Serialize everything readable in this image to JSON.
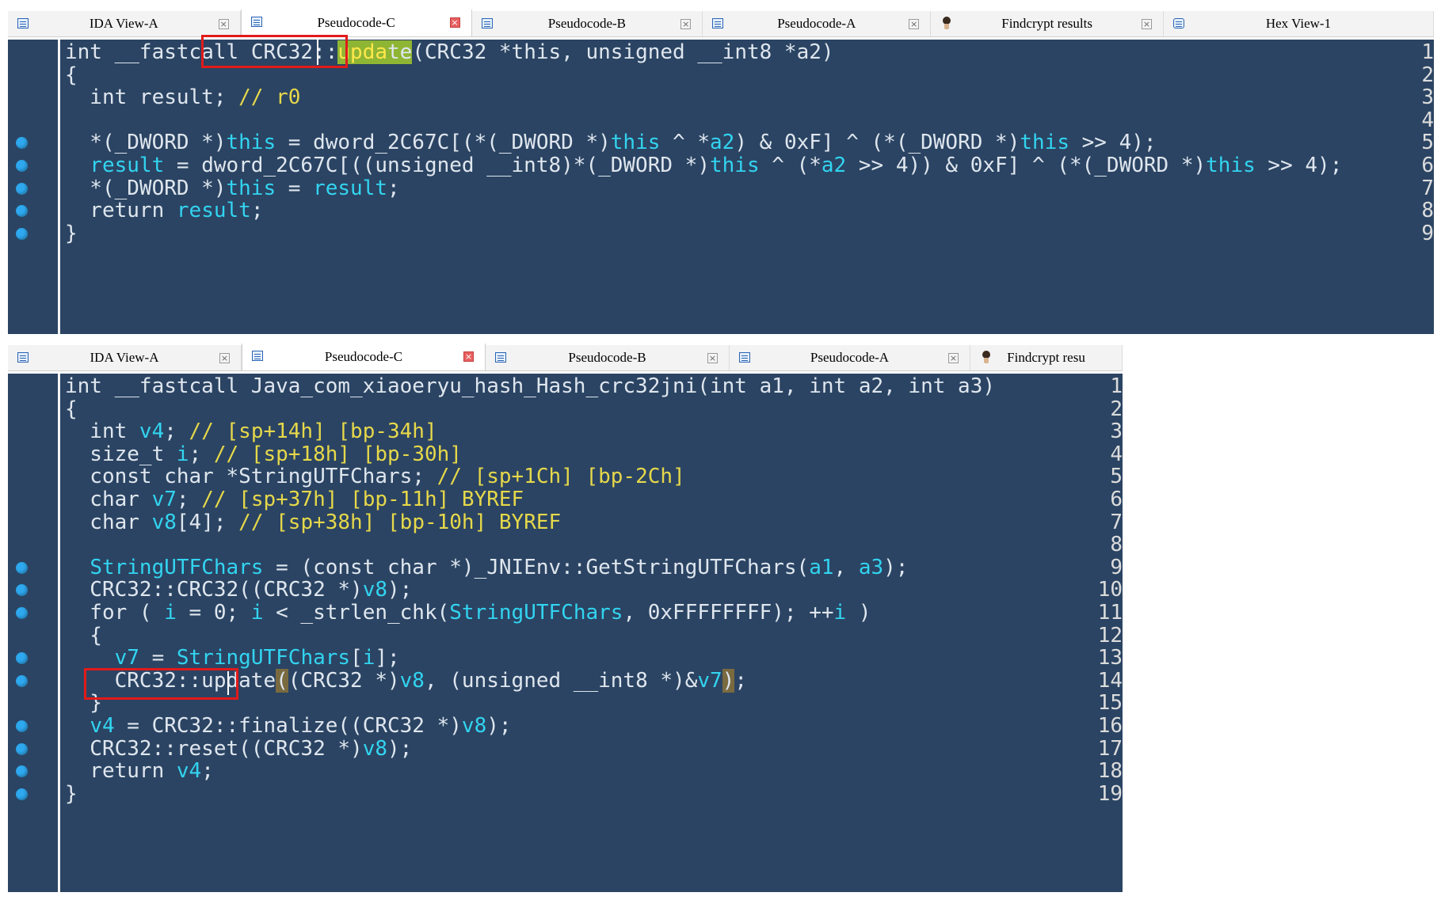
{
  "top": {
    "tabs": [
      {
        "label": "IDA View-A",
        "icon": "ida-view-icon",
        "active": false
      },
      {
        "label": "Pseudocode-C",
        "icon": "pseudocode-icon",
        "active": true
      },
      {
        "label": "Pseudocode-B",
        "icon": "pseudocode-icon",
        "active": false
      },
      {
        "label": "Pseudocode-A",
        "icon": "pseudocode-icon",
        "active": false
      },
      {
        "label": "Findcrypt results",
        "icon": "findcrypt-icon",
        "active": false
      },
      {
        "label": "Hex View-1",
        "icon": "hex-view-icon",
        "active": false
      }
    ],
    "lines": [
      {
        "n": "1",
        "bp": false
      },
      {
        "n": "2",
        "bp": false
      },
      {
        "n": "3",
        "bp": false
      },
      {
        "n": "4",
        "bp": false
      },
      {
        "n": "5",
        "bp": true
      },
      {
        "n": "6",
        "bp": true
      },
      {
        "n": "7",
        "bp": true
      },
      {
        "n": "8",
        "bp": true
      },
      {
        "n": "9",
        "bp": true
      }
    ]
  },
  "bottom": {
    "tabs": [
      {
        "label": "IDA View-A",
        "icon": "ida-view-icon",
        "active": false
      },
      {
        "label": "Pseudocode-C",
        "icon": "pseudocode-icon",
        "active": true
      },
      {
        "label": "Pseudocode-B",
        "icon": "pseudocode-icon",
        "active": false
      },
      {
        "label": "Pseudocode-A",
        "icon": "pseudocode-icon",
        "active": false
      },
      {
        "label": "Findcrypt resu",
        "icon": "findcrypt-icon",
        "active": false
      }
    ],
    "lines": [
      {
        "n": "1",
        "bp": false
      },
      {
        "n": "2",
        "bp": false
      },
      {
        "n": "3",
        "bp": false
      },
      {
        "n": "4",
        "bp": false
      },
      {
        "n": "5",
        "bp": false
      },
      {
        "n": "6",
        "bp": false
      },
      {
        "n": "7",
        "bp": false
      },
      {
        "n": "8",
        "bp": false
      },
      {
        "n": "9",
        "bp": true
      },
      {
        "n": "10",
        "bp": true
      },
      {
        "n": "11",
        "bp": true
      },
      {
        "n": "12",
        "bp": false
      },
      {
        "n": "13",
        "bp": true
      },
      {
        "n": "14",
        "bp": true
      },
      {
        "n": "15",
        "bp": false
      },
      {
        "n": "16",
        "bp": true
      },
      {
        "n": "17",
        "bp": true
      },
      {
        "n": "18",
        "bp": true
      },
      {
        "n": "19",
        "bp": true
      }
    ]
  },
  "code": {
    "t1": [
      "int",
      " __fastcall ",
      "CRC32::",
      "upda",
      "te",
      "(CRC32 *this, unsigned __int8 *a2)"
    ],
    "t2": "{",
    "t3": [
      "  int result; ",
      "// r0"
    ],
    "t4": "",
    "t5": [
      "  *(_DWORD *)",
      "this",
      " = dword_2C67C[(*(_DWORD *)",
      "this",
      " ^ *",
      "a2",
      ") & 0xF] ^ (*(_DWORD *)",
      "this",
      " >> 4);"
    ],
    "t6": [
      "  ",
      "result",
      " = dword_2C67C[((unsigned __int8)*(_DWORD *)",
      "this",
      " ^ (*",
      "a2",
      " >> 4)) & 0xF] ^ (*(_DWORD *)",
      "this",
      " >> 4);"
    ],
    "t7": [
      "  *(_DWORD *)",
      "this",
      " = ",
      "result",
      ";"
    ],
    "t8": [
      "  return ",
      "result",
      ";"
    ],
    "t9": "}",
    "b1": [
      "int __fastcall Java_com_xiaoeryu_hash_Hash_crc32jni(int a1, int a2, int a3)"
    ],
    "b2": "{",
    "b3": [
      "  int ",
      "v4",
      "; ",
      "// [sp+14h] [bp-34h]"
    ],
    "b4": [
      "  size_t ",
      "i",
      "; ",
      "// [sp+18h] [bp-30h]"
    ],
    "b5": [
      "  const char *StringUTFChars; ",
      "// [sp+1Ch] [bp-2Ch]"
    ],
    "b6": [
      "  char ",
      "v7",
      "; ",
      "// [sp+37h] [bp-11h] BYREF"
    ],
    "b7": [
      "  char ",
      "v8",
      "[4]; ",
      "// [sp+38h] [bp-10h] BYREF"
    ],
    "b8": "",
    "b9": [
      "  ",
      "StringUTFChars",
      " = (const char *)_JNIEnv::GetStringUTFChars(",
      "a1",
      ", ",
      "a3",
      ");"
    ],
    "b10": [
      "  CRC32::CRC32((CRC32 *)",
      "v8",
      ");"
    ],
    "b11": [
      "  for ( ",
      "i",
      " = 0; ",
      "i",
      " < _strlen_chk(",
      "StringUTFChars",
      ", 0xFFFFFFFF); ++",
      "i",
      " )"
    ],
    "b12": "  {",
    "b13": [
      "    ",
      "v7",
      " = ",
      "StringUTFChars",
      "[",
      "i",
      "];"
    ],
    "b14": [
      "    CRC32::update",
      "(",
      "(CRC32 *)",
      "v8",
      ", (unsigned __int8 *)&",
      "v7",
      ")",
      ";"
    ],
    "b15": "  }",
    "b16": [
      "  ",
      "v4",
      " = CRC32::finalize((CRC32 *)",
      "v8",
      ");"
    ],
    "b17": [
      "  CRC32::reset((CRC32 *)",
      "v8",
      ");"
    ],
    "b18": [
      "  return ",
      "v4",
      ";"
    ],
    "b19": "}"
  },
  "colors": {
    "background": "#2b4463",
    "identifier": "#32d4f0",
    "comment": "#e6d84a",
    "highlight": "#8fb534",
    "annotation_box": "#e21a1a",
    "breakpoint": "#2ea9f0"
  }
}
